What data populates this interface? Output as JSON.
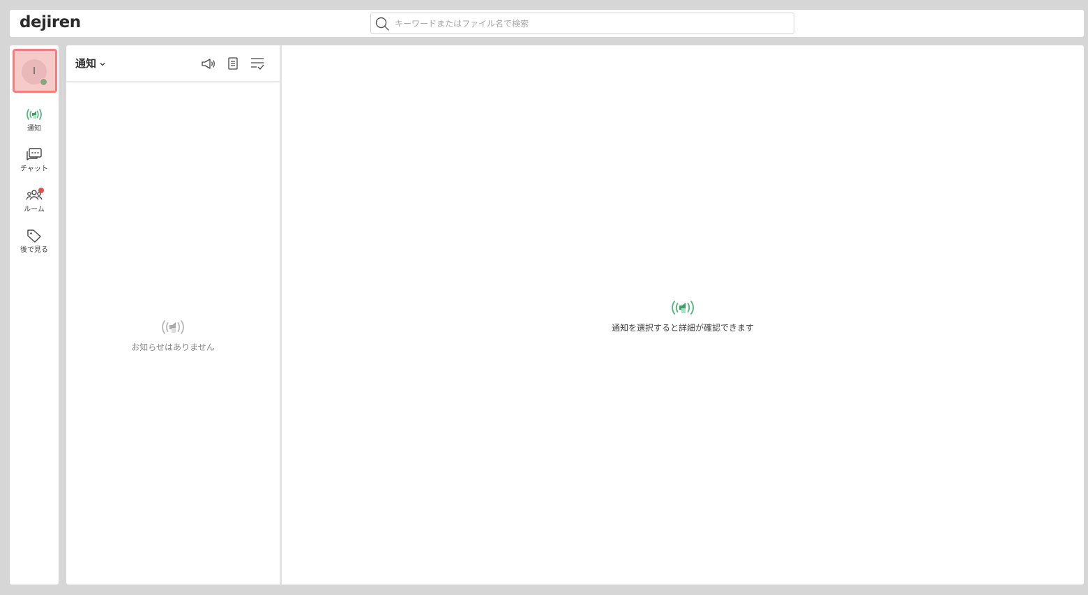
{
  "app": {
    "logo": "dejiren"
  },
  "search": {
    "placeholder": "キーワードまたはファイル名で検索",
    "icon": "search-icon"
  },
  "user": {
    "initial": "I",
    "status_color": "#8aa57c",
    "highlight_color": "#f07f7f"
  },
  "sidebar": {
    "items": [
      {
        "label": "通知",
        "icon": "broadcast-icon",
        "active": true
      },
      {
        "label": "チャット",
        "icon": "chat-icon"
      },
      {
        "label": "ルーム",
        "icon": "people-icon",
        "badge": true
      },
      {
        "label": "後で見る",
        "icon": "tag-icon"
      }
    ]
  },
  "list": {
    "title": "通知",
    "empty_text": "お知らせはありません"
  },
  "detail": {
    "empty_text": "通知を選択すると詳細が確認できます"
  },
  "colors": {
    "accent": "#5cb882",
    "badge": "#d9534f"
  }
}
